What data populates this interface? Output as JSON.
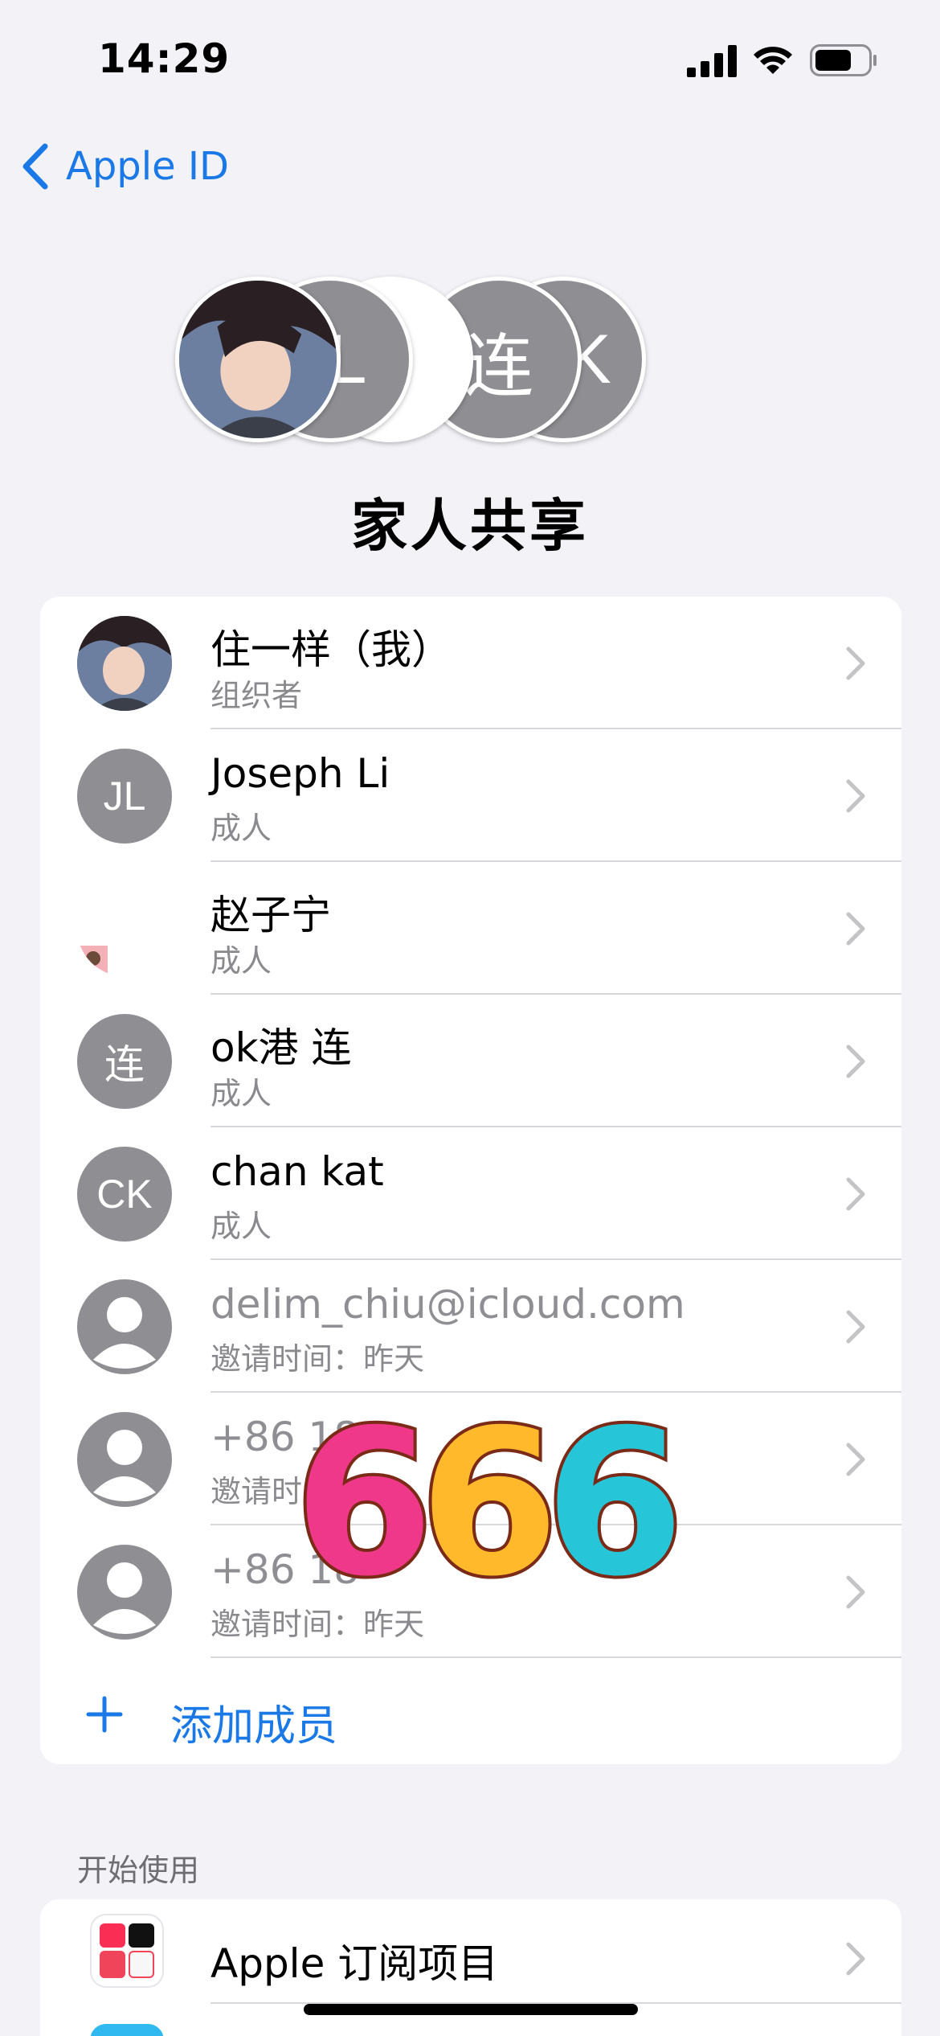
{
  "status_bar": {
    "time": "14:29"
  },
  "nav": {
    "back_label": "Apple ID"
  },
  "header": {
    "title": "家人共享",
    "avatars": [
      "",
      "JL",
      "",
      "连",
      "CK"
    ]
  },
  "members": [
    {
      "name": "住一样（我）",
      "role": "组织者",
      "initials": "",
      "avatar": "photo",
      "pending": false
    },
    {
      "name": "Joseph Li",
      "role": "成人",
      "initials": "JL",
      "avatar": "initials",
      "pending": false
    },
    {
      "name": "赵子宁",
      "role": "成人",
      "initials": "",
      "avatar": "none",
      "pending": false
    },
    {
      "name": "ok港 连",
      "role": "成人",
      "initials": "连",
      "avatar": "initials",
      "pending": false
    },
    {
      "name": "chan kat",
      "role": "成人",
      "initials": "CK",
      "avatar": "initials",
      "pending": false
    },
    {
      "name": "delim_chiu@icloud.com",
      "role": "邀请时间：昨天",
      "initials": "",
      "avatar": "placeholder",
      "pending": true
    },
    {
      "name": "+86 18",
      "role": "邀请时间",
      "initials": "",
      "avatar": "placeholder",
      "pending": true
    },
    {
      "name": "+86 18",
      "role": "邀请时间：昨天",
      "initials": "",
      "avatar": "placeholder",
      "pending": true
    }
  ],
  "add_member_label": "添加成员",
  "section_header": "开始使用",
  "subscriptions": {
    "title": "Apple 订阅项目"
  },
  "sticker": {
    "text": [
      "6",
      "6",
      "6"
    ]
  },
  "colors": {
    "accent": "#1a79e6",
    "background": "#f2f2f7",
    "avatar_gray": "#8e8e93"
  }
}
